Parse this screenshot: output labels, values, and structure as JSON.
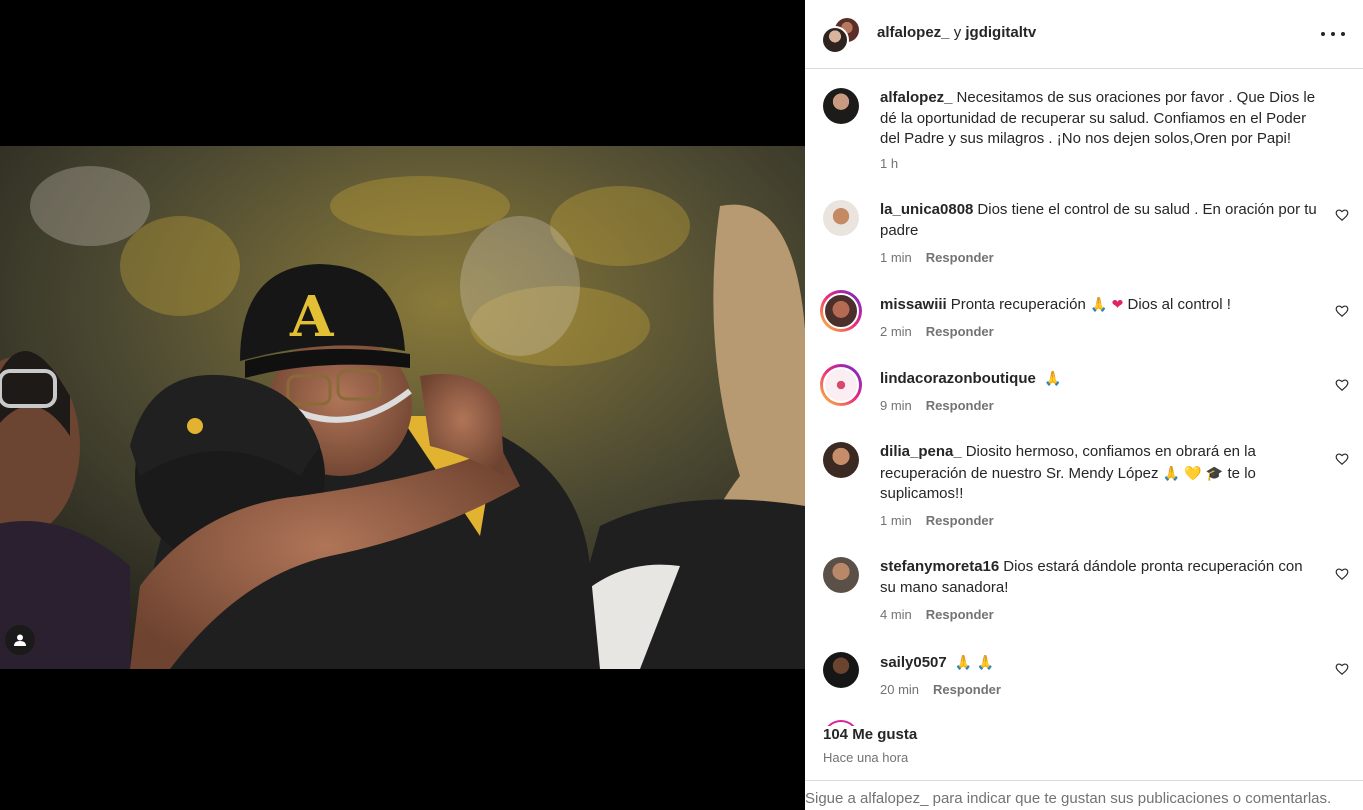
{
  "header": {
    "user1": "alfalopez_",
    "joiner": "y",
    "user2": "jgdigitaltv"
  },
  "post": {
    "username": "alfalopez_",
    "caption": "Necesitamos de sus oraciones por favor . Que Dios le dé la oportunidad de recuperar su salud. Confiamos en el Poder del Padre y sus milagros . ¡No nos dejen solos,Oren por Papi!",
    "time": "1 h"
  },
  "reply_label": "Responder",
  "comments": [
    {
      "username": "la_unica0808",
      "text": "Dios tiene el control de su salud . En oración por tu padre",
      "time": "1 min"
    },
    {
      "username": "missawiii",
      "text": "Pronta recuperación",
      "text_after": "Dios al control !",
      "time": "2 min"
    },
    {
      "username": "lindacorazonboutique",
      "text": "",
      "time": "9 min"
    },
    {
      "username": "dilia_pena_",
      "text": "Diosito hermoso, confiamos en obrará en la recuperación de nuestro Sr. Mendy López",
      "text_after": "te lo suplicamos!!",
      "time": "1 min"
    },
    {
      "username": "stefanymoreta16",
      "text": "Dios estará dándole pronta recuperación con su mano sanadora!",
      "time": "4 min"
    },
    {
      "username": "saily0507",
      "text": "",
      "time": "20 min"
    }
  ],
  "likes": "104 Me gusta",
  "posted_ago": "Hace una hora",
  "footer": "Sigue a alfalopez_ para indicar que te gustan sus publicaciones o comentarlas.",
  "icons": {
    "more": "more-options-icon",
    "heart": "heart-outline-icon",
    "tag": "user-tag-icon",
    "pray": "🙏",
    "red_heart": "❤",
    "yellow_heart": "💛",
    "graduation": "🎓"
  }
}
